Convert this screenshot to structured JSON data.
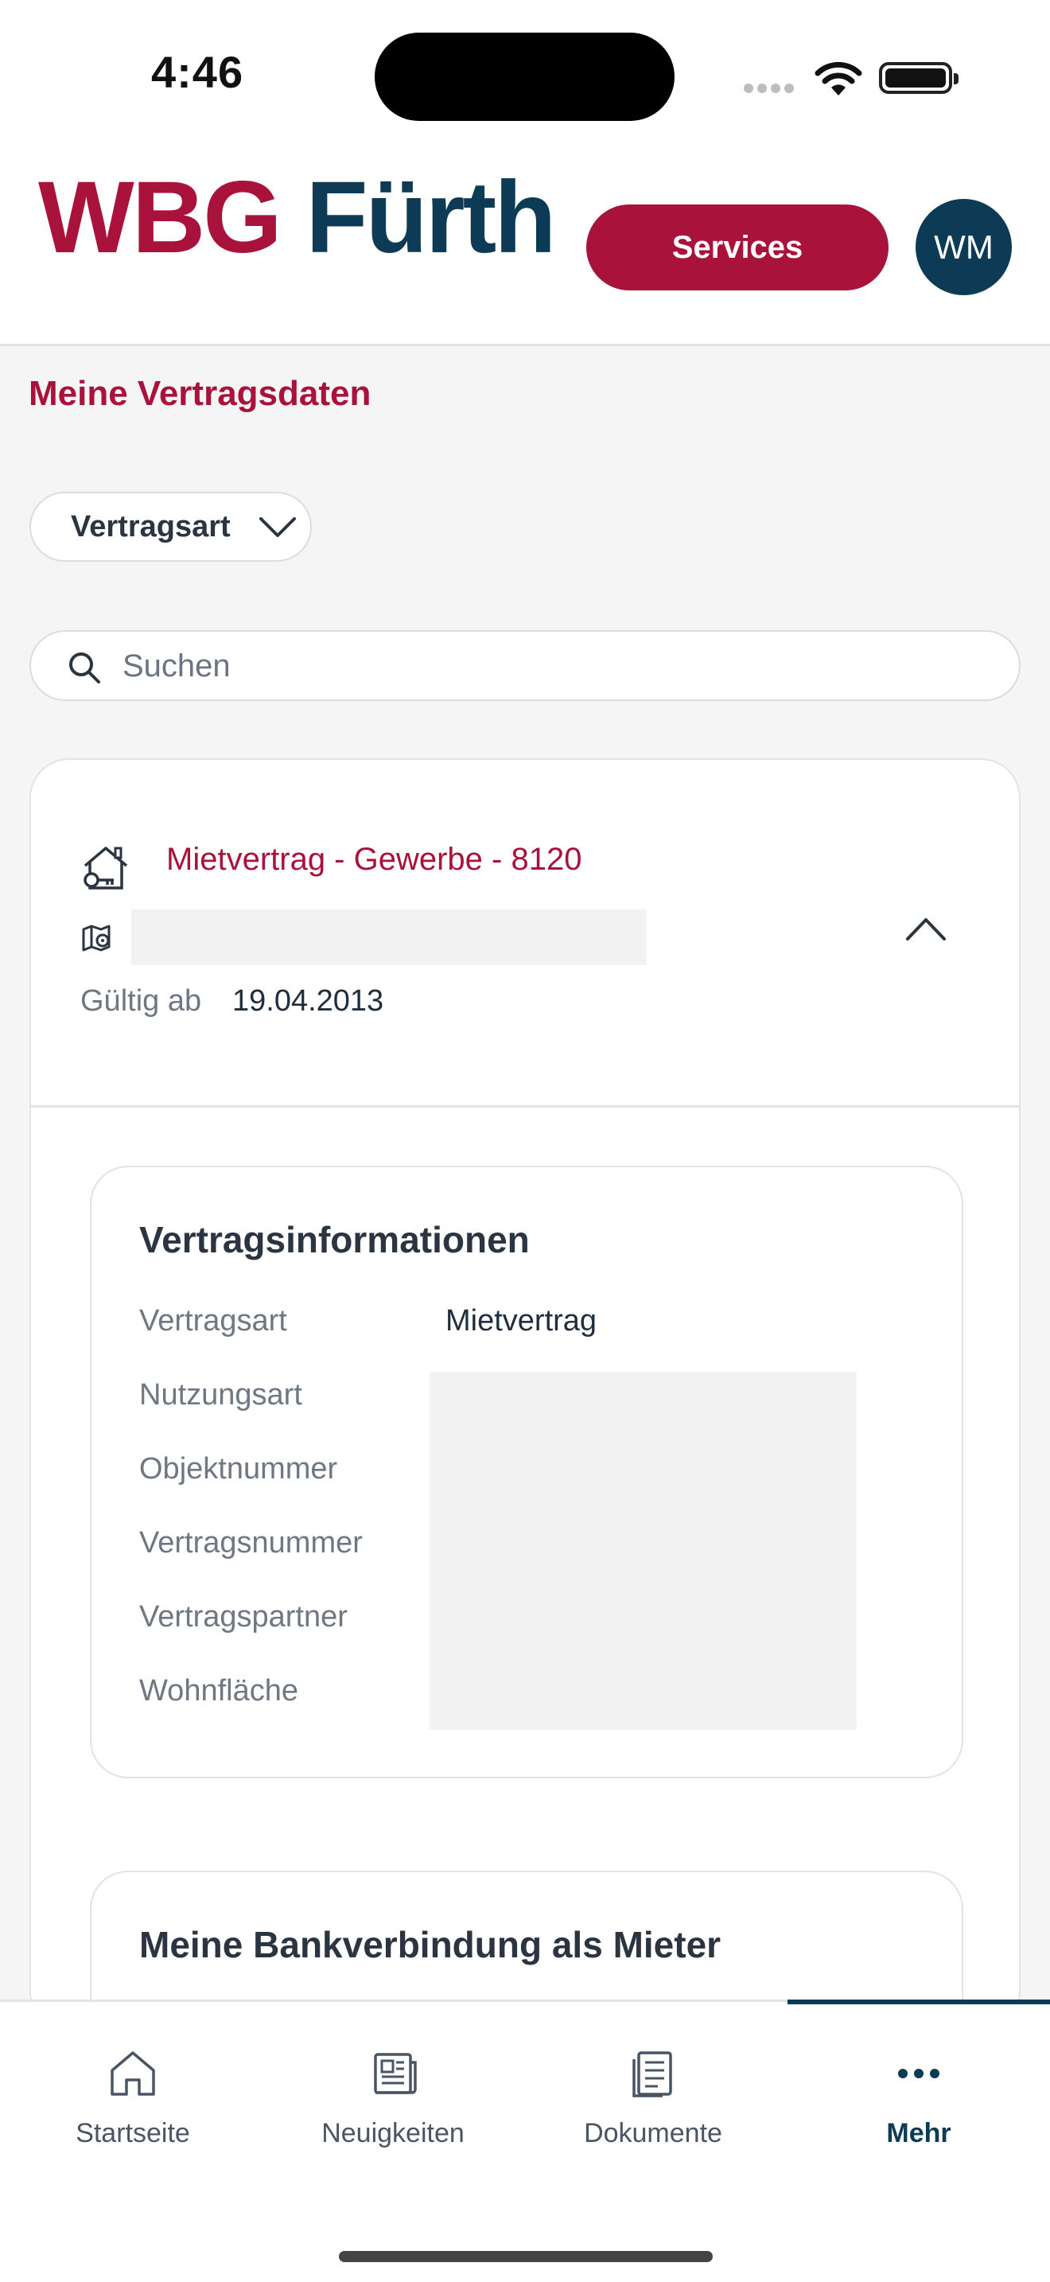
{
  "status_bar": {
    "time": "4:46"
  },
  "header": {
    "logo_part1": "WBG",
    "logo_part2": "Fürth",
    "services_label": "Services",
    "avatar_initials": "WM",
    "brand_color": "#a8123b",
    "secondary_color": "#0d3b56"
  },
  "page": {
    "title": "Meine Vertragsdaten",
    "filter_label": "Vertragsart",
    "search_placeholder": "Suchen"
  },
  "contract": {
    "title": "Mietvertrag - Gewerbe - 8120",
    "valid_label": "Gültig ab",
    "valid_value": "19.04.2013",
    "info": {
      "title": "Vertragsinformationen",
      "rows": [
        {
          "label": "Vertragsart",
          "value": "Mietvertrag"
        },
        {
          "label": "Nutzungsart",
          "value": ""
        },
        {
          "label": "Objektnummer",
          "value": ""
        },
        {
          "label": "Vertragsnummer",
          "value": ""
        },
        {
          "label": "Vertragspartner",
          "value": ""
        },
        {
          "label": "Wohnfläche",
          "value": ""
        }
      ]
    },
    "bank": {
      "title": "Meine Bankverbindung als Mieter"
    }
  },
  "bottom_nav": {
    "items": [
      {
        "label": "Startseite",
        "icon": "home-icon",
        "active": false
      },
      {
        "label": "Neuigkeiten",
        "icon": "newspaper-icon",
        "active": false
      },
      {
        "label": "Dokumente",
        "icon": "document-icon",
        "active": false
      },
      {
        "label": "Mehr",
        "icon": "more-icon",
        "active": true
      }
    ]
  }
}
